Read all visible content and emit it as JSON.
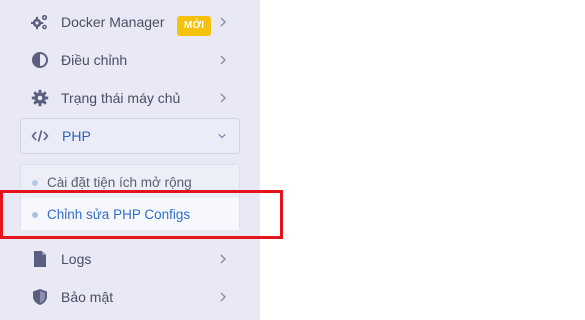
{
  "sidebar": {
    "items": [
      {
        "label": "Docker Manager",
        "icon": "gears-icon",
        "badge": "MỚI",
        "chevron": "chevron-right"
      },
      {
        "label": "Điều chỉnh",
        "icon": "contrast-icon",
        "chevron": "chevron-right"
      },
      {
        "label": "Trạng thái máy chủ",
        "icon": "gear-icon",
        "chevron": "chevron-right"
      },
      {
        "label": "PHP",
        "icon": "code-icon",
        "chevron": "chevron-down",
        "expanded": true
      },
      {
        "label": "Logs",
        "icon": "file-icon",
        "chevron": "chevron-right"
      },
      {
        "label": "Bảo mật",
        "icon": "shield-icon",
        "chevron": "chevron-right"
      }
    ],
    "php_submenu": [
      {
        "label": "Cài đặt tiện ích mở rộng",
        "selected": false
      },
      {
        "label": "Chỉnh sửa PHP Configs",
        "selected": true
      }
    ]
  },
  "colors": {
    "sidebar_bg": "#e8e9f4",
    "icon": "#5a5e80",
    "active_text": "#2f63b8",
    "badge_bg": "#f4c20d",
    "highlight": "#e3141b"
  }
}
